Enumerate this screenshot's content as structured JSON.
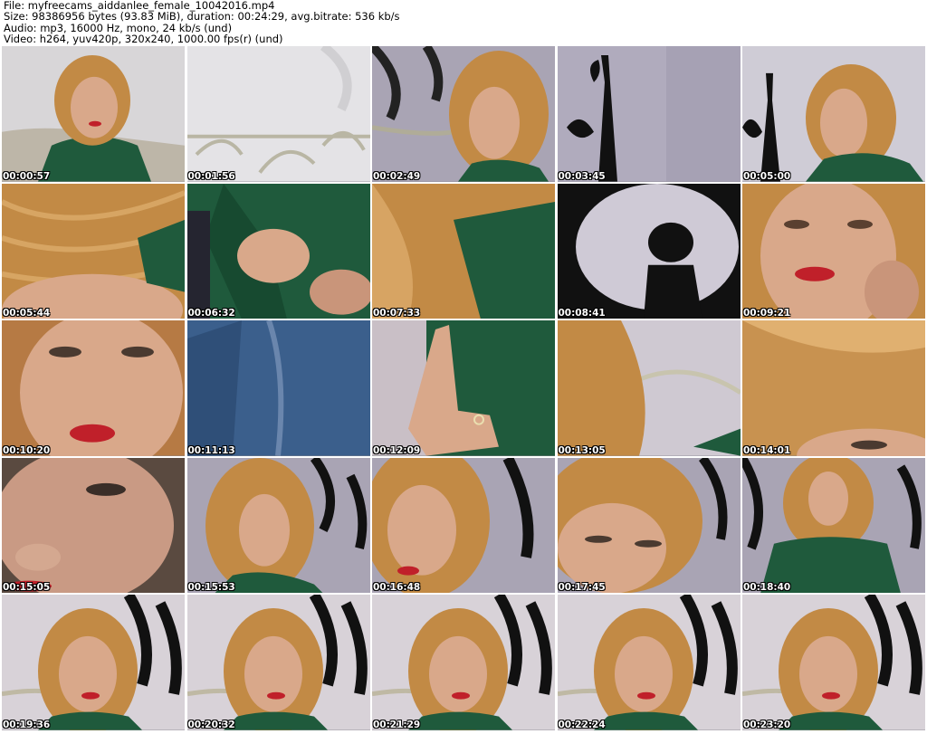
{
  "header": {
    "file_label": "File: ",
    "file_value": "myfreecams_aiddanlee_female_10042016.mp4",
    "size_line": "Size: 98386956 bytes (93.83 MiB), duration: 00:24:29, avg.bitrate: 536 kb/s",
    "audio_line": "Audio: mp3, 16000 Hz, mono, 24 kb/s (und)",
    "video_line": "Video: h264, yuv420p, 320x240, 1000.00 fps(r) (und)"
  },
  "thumbnails": [
    {
      "timestamp": "00:00:57",
      "scene": "woman-green-shirt"
    },
    {
      "timestamp": "00:01:56",
      "scene": "bed-headboard"
    },
    {
      "timestamp": "00:02:49",
      "scene": "woman-head-turned"
    },
    {
      "timestamp": "00:03:45",
      "scene": "wall-eiffel"
    },
    {
      "timestamp": "00:05:00",
      "scene": "woman-eiffel"
    },
    {
      "timestamp": "00:05:44",
      "scene": "hair-closeup"
    },
    {
      "timestamp": "00:06:32",
      "scene": "green-shirt-hand"
    },
    {
      "timestamp": "00:07:33",
      "scene": "hair-shirt-blur"
    },
    {
      "timestamp": "00:08:41",
      "scene": "wall-silhouette"
    },
    {
      "timestamp": "00:09:21",
      "scene": "face-red-lips"
    },
    {
      "timestamp": "00:10:20",
      "scene": "face-eyes"
    },
    {
      "timestamp": "00:11:13",
      "scene": "denim"
    },
    {
      "timestamp": "00:12:09",
      "scene": "hand-finger"
    },
    {
      "timestamp": "00:13:05",
      "scene": "hair-headboard"
    },
    {
      "timestamp": "00:14:01",
      "scene": "hair-eye"
    },
    {
      "timestamp": "00:15:05",
      "scene": "face-closeup"
    },
    {
      "timestamp": "00:15:53",
      "scene": "woman-looking-down"
    },
    {
      "timestamp": "00:16:48",
      "scene": "woman-face-left"
    },
    {
      "timestamp": "00:17:45",
      "scene": "face-eyes-closed"
    },
    {
      "timestamp": "00:18:40",
      "scene": "woman-sitting"
    },
    {
      "timestamp": "00:19:36",
      "scene": "woman-portrait"
    },
    {
      "timestamp": "00:20:32",
      "scene": "woman-portrait"
    },
    {
      "timestamp": "00:21:29",
      "scene": "woman-portrait"
    },
    {
      "timestamp": "00:22:24",
      "scene": "woman-portrait"
    },
    {
      "timestamp": "00:23:20",
      "scene": "woman-portrait"
    }
  ],
  "colors": {
    "wall": "#a9a4b4",
    "skin": "#d9a88a",
    "hair": "#c28a45",
    "shirt": "#1f5a3c",
    "lips": "#c0202a",
    "denim": "#3b5f8c"
  }
}
